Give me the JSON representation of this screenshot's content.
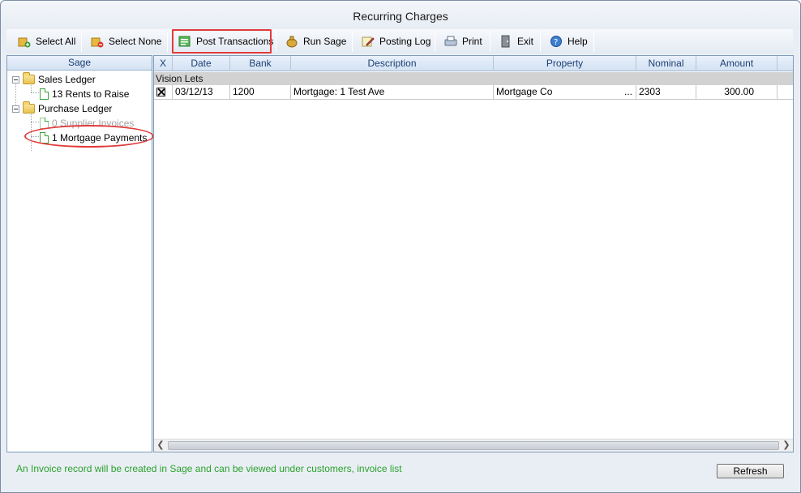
{
  "window": {
    "title": "Recurring Charges"
  },
  "toolbar": {
    "select_all": "Select All",
    "select_none": "Select None",
    "post_transactions": "Post Transactions",
    "run_sage": "Run Sage",
    "posting_log": "Posting Log",
    "print": "Print",
    "exit": "Exit",
    "help": "Help"
  },
  "sidebar": {
    "header": "Sage",
    "tree": {
      "sales_ledger": "Sales Ledger",
      "rents_to_raise": "13 Rents to Raise",
      "purchase_ledger": "Purchase Ledger",
      "supplier_invoices": "0 Supplier Invoices",
      "mortgage_payments": "1 Mortgage Payments"
    }
  },
  "grid": {
    "columns": {
      "x": "X",
      "date": "Date",
      "bank": "Bank",
      "description": "Description",
      "property": "Property",
      "nominal": "Nominal",
      "amount": "Amount"
    },
    "group": "Vision Lets",
    "rows": [
      {
        "checked": true,
        "date": "03/12/13",
        "bank": "1200",
        "description": "Mortgage: 1 Test Ave",
        "property": "Mortgage Co",
        "ellipsis": "...",
        "nominal": "2303",
        "amount": "300.00"
      }
    ]
  },
  "status": {
    "message": "An Invoice record will be created in Sage and can be viewed under customers, invoice list",
    "color": "#2aa22a"
  },
  "buttons": {
    "refresh": "Refresh"
  },
  "highlight_color": "#e23b3b"
}
